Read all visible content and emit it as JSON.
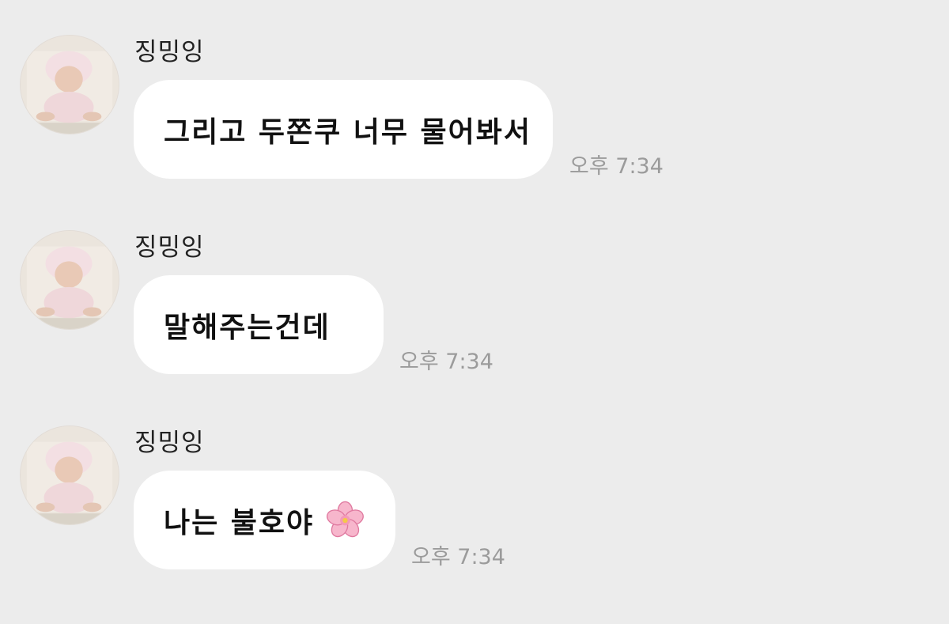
{
  "messages": [
    {
      "sender": "징밍잉",
      "text": "그리고 두쫀쿠 너무 물어봐서",
      "time": "오후 7:34",
      "emoji": ""
    },
    {
      "sender": "징밍잉",
      "text": "말해주는건데",
      "time": "오후 7:34",
      "emoji": ""
    },
    {
      "sender": "징밍잉",
      "text": "나는 불호야",
      "time": "오후 7:34",
      "emoji": "cherry-blossom-icon"
    }
  ],
  "colors": {
    "background": "#ececec",
    "bubble": "#ffffff",
    "timestamp": "#9b9b9b",
    "name": "#222222"
  }
}
